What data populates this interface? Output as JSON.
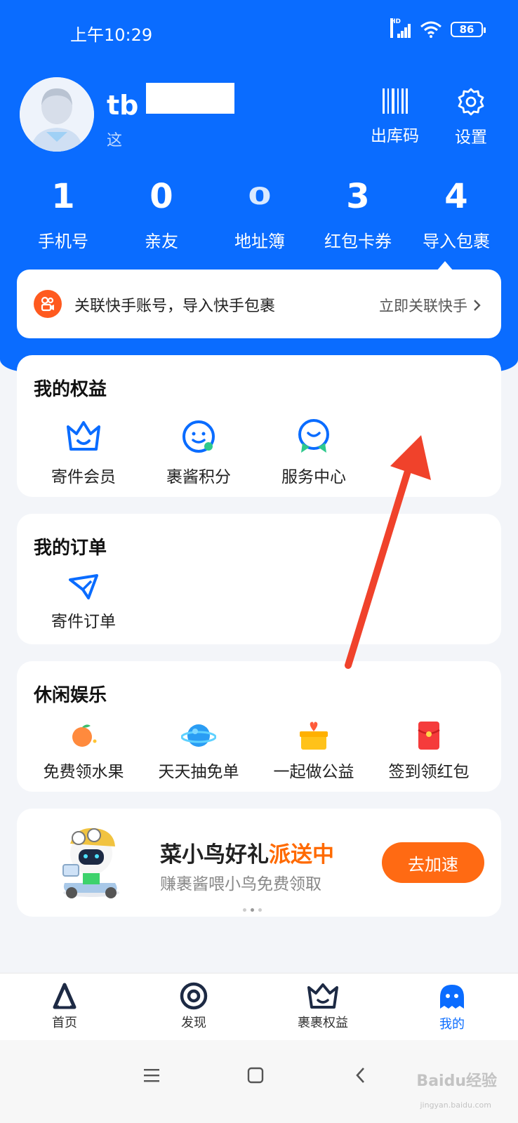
{
  "status_bar": {
    "time": "上午10:29",
    "network": "HD",
    "battery": "86"
  },
  "profile": {
    "username_visible": "tb",
    "subtitle_visible": "这",
    "checkout_code_label": "出库码",
    "settings_label": "设置"
  },
  "stats": [
    {
      "value": "1",
      "label": "手机号"
    },
    {
      "value": "0",
      "label": "亲友"
    },
    {
      "value": "0",
      "label": "地址簿"
    },
    {
      "value": "3",
      "label": "红包卡券"
    },
    {
      "value": "4",
      "label": "导入包裹"
    }
  ],
  "link_banner": {
    "text": "关联快手账号，导入快手包裹",
    "action": "立即关联快手"
  },
  "benefits": {
    "title": "我的权益",
    "items": [
      {
        "label": "寄件会员",
        "icon": "crown-icon"
      },
      {
        "label": "裹酱积分",
        "icon": "smile-face-icon"
      },
      {
        "label": "服务中心",
        "icon": "service-heart-icon"
      }
    ]
  },
  "orders": {
    "title": "我的订单",
    "items": [
      {
        "label": "寄件订单",
        "icon": "paper-plane-icon"
      }
    ]
  },
  "leisure": {
    "title": "休闲娱乐",
    "items": [
      {
        "label": "免费领水果",
        "icon": "orange-fruit-icon"
      },
      {
        "label": "天天抽免单",
        "icon": "planet-icon"
      },
      {
        "label": "一起做公益",
        "icon": "gift-heart-icon"
      },
      {
        "label": "签到领红包",
        "icon": "red-envelope-icon"
      }
    ]
  },
  "promo": {
    "title_main": "菜小鸟好礼",
    "title_highlight": "派送中",
    "subtitle": "赚裹酱喂小鸟免费领取",
    "button": "去加速"
  },
  "tabbar": [
    {
      "label": "首页",
      "icon": "home-a-icon",
      "active": false
    },
    {
      "label": "发现",
      "icon": "discover-eye-icon",
      "active": false
    },
    {
      "label": "裹裹权益",
      "icon": "crown-icon",
      "active": false
    },
    {
      "label": "我的",
      "icon": "ghost-profile-icon",
      "active": true
    }
  ],
  "colors": {
    "brand_blue": "#0a6cff",
    "accent_orange": "#ff6a13",
    "arrow_red": "#f0422b"
  },
  "watermark": {
    "text": "Baidu经验",
    "sub": "jingyan.baidu.com"
  }
}
